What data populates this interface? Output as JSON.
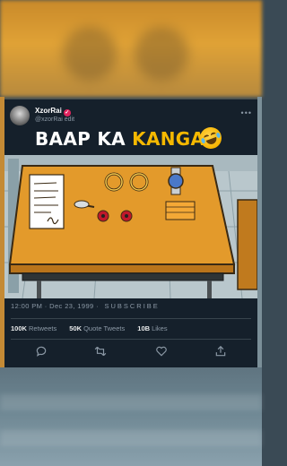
{
  "tweet": {
    "display_name": "XzorRai",
    "handle": "@xzorRai edit",
    "verified_icon": "verified-badge-icon",
    "more_icon": "more-options-icon",
    "more_glyph": "•••",
    "caption_part1": "BAAP KA ",
    "caption_part2": "KANGAN",
    "caption_emoji": "rolling-on-floor-laughing-emoji",
    "time_date": "12:00 PM · Dec 23, 1999 · ",
    "subscribe_text": "SUBSCRIBE",
    "retweets_count": "100K",
    "retweets_label": "Retweets",
    "quote_count": "50K",
    "quote_label": "Quote Tweets",
    "likes_count": "10B",
    "likes_label": "Likes",
    "actions": [
      "reply-icon",
      "retweet-icon",
      "like-icon",
      "share-icon"
    ]
  },
  "colors": {
    "card_bg": "#15202b",
    "accent_yellow": "#f5b800",
    "muted_text": "#8b98a5",
    "table_orange": "#e39a2b"
  }
}
